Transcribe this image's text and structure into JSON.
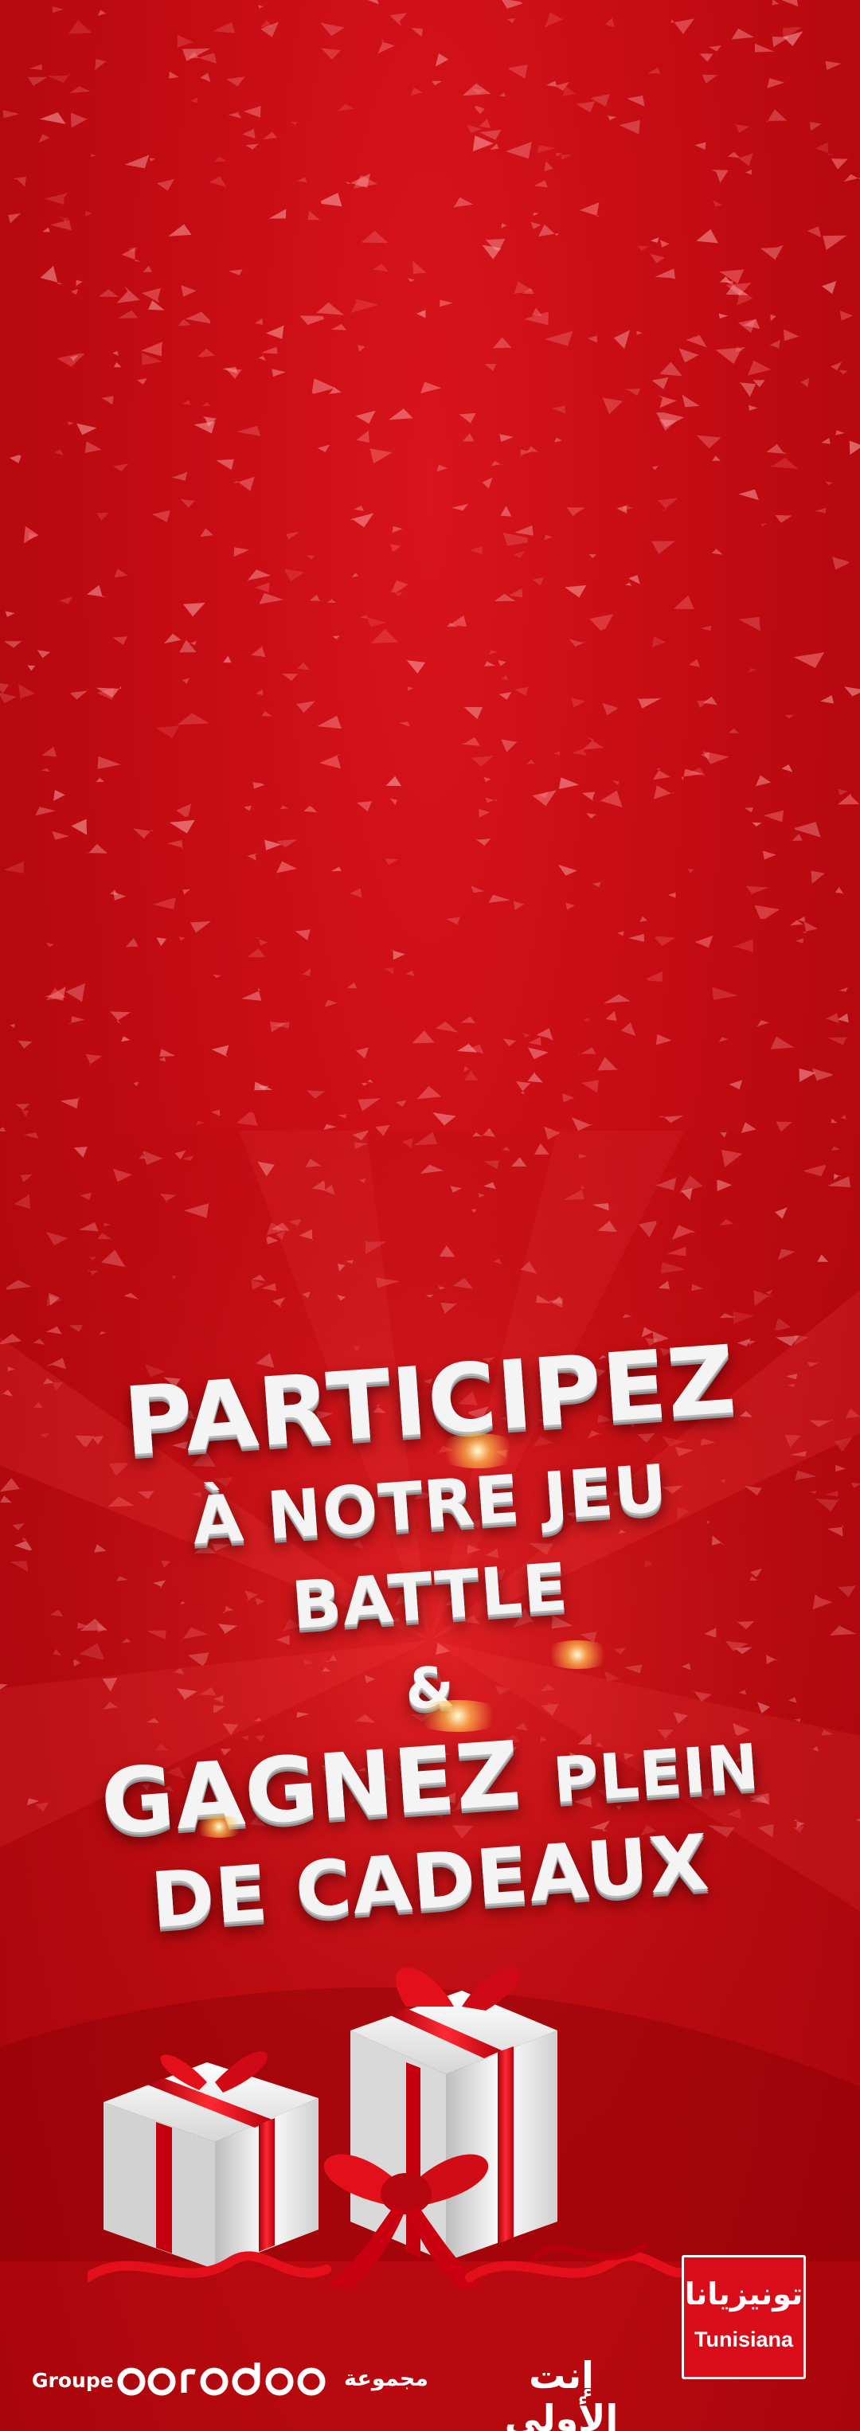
{
  "headline": {
    "line1": "PARTICIPEZ",
    "line2": "À NOTRE JEU",
    "line3": "BATTLE",
    "line4": "&",
    "line5_big": "GAGNEZ",
    "line5_small": "PLEIN",
    "line6": "DE CADEAUX"
  },
  "footer": {
    "groupe_label": "Groupe",
    "brand_logo_text": "ooredoo",
    "group_label_ar": "مجموعة",
    "slogan_ar": "إنت الأولى"
  },
  "logo": {
    "name_ar": "تونيزيانا",
    "name_latin": "Tunisiana"
  },
  "colors": {
    "background": "#c50a12",
    "text": "#f4f4f4",
    "gift_ribbon": "#e3101b",
    "logo_bg": "#d90d19"
  },
  "icons": {
    "decor": "confetti",
    "illustration": "gift-boxes",
    "brand_mark": "ooredoo-logo"
  }
}
